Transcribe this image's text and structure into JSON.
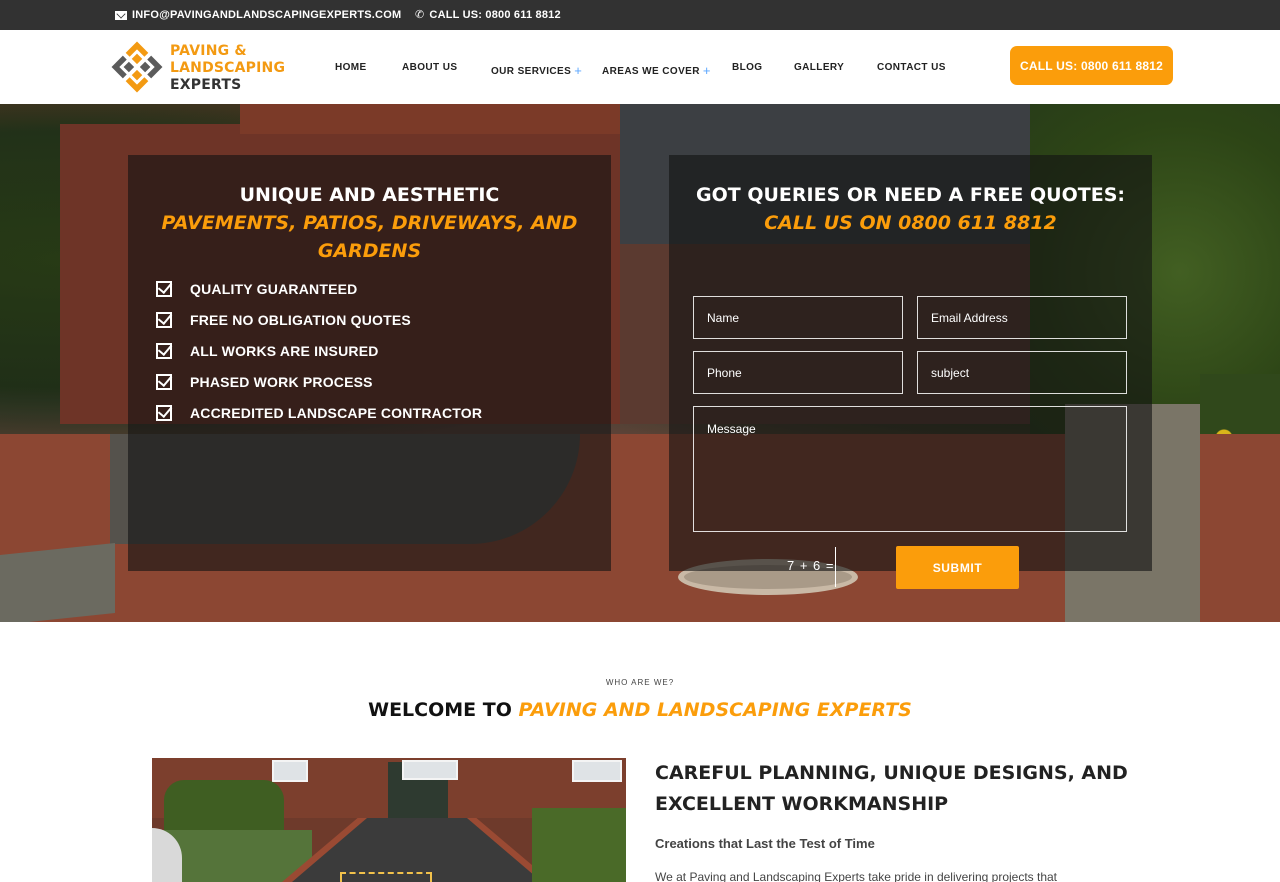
{
  "topbar": {
    "email": "INFO@PAVINGANDLANDSCAPINGEXPERTS.COM",
    "phone": "CALL US: 0800 611 8812"
  },
  "header": {
    "logo": {
      "line1": "PAVING &",
      "line2": "LANDSCAPING",
      "line3": "EXPERTS"
    },
    "nav": [
      {
        "label": "HOME"
      },
      {
        "label": "ABOUT US"
      },
      {
        "label": "OUR SERVICES",
        "plus": "+"
      },
      {
        "label": "AREAS WE COVER",
        "plus": "+"
      },
      {
        "label": "BLOG"
      },
      {
        "label": "GALLERY"
      },
      {
        "label": "CONTACT US"
      }
    ],
    "cta": "CALL US: 0800 611 8812"
  },
  "hero": {
    "left": {
      "title_line1": "UNIQUE AND AESTHETIC",
      "title_line2": "PAVEMENTS, PATIOS, DRIVEWAYS, AND",
      "title_line3": "GARDENS",
      "features": [
        "QUALITY GUARANTEED",
        "FREE NO OBLIGATION QUOTES",
        "ALL WORKS ARE INSURED",
        "PHASED WORK PROCESS",
        "ACCREDITED LANDSCAPE CONTRACTOR"
      ]
    },
    "right": {
      "title_line1": "GOT QUERIES OR NEED A FREE QUOTES:",
      "title_line2": "CALL US ON 0800 611 8812",
      "form": {
        "name_placeholder": "Name",
        "email_placeholder": "Email Address",
        "phone_placeholder": "Phone",
        "subject_placeholder": "subject",
        "message_placeholder": "Message",
        "captcha": "7 + 6 =",
        "submit": "SUBMIT"
      }
    }
  },
  "about": {
    "eyebrow": "WHO ARE WE?",
    "welcome_black": "WELCOME TO ",
    "welcome_orange": "PAVING AND LANDSCAPING EXPERTS",
    "heading_line1": "CAREFUL PLANNING, UNIQUE DESIGNS, AND",
    "heading_line2": "EXCELLENT WORKMANSHIP",
    "subheading": "Creations that Last the Test of Time",
    "paragraph": "We at Paving and Landscaping Experts take pride in delivering projects that"
  },
  "colors": {
    "accent": "#fb9d0b",
    "topbar": "#323232"
  }
}
